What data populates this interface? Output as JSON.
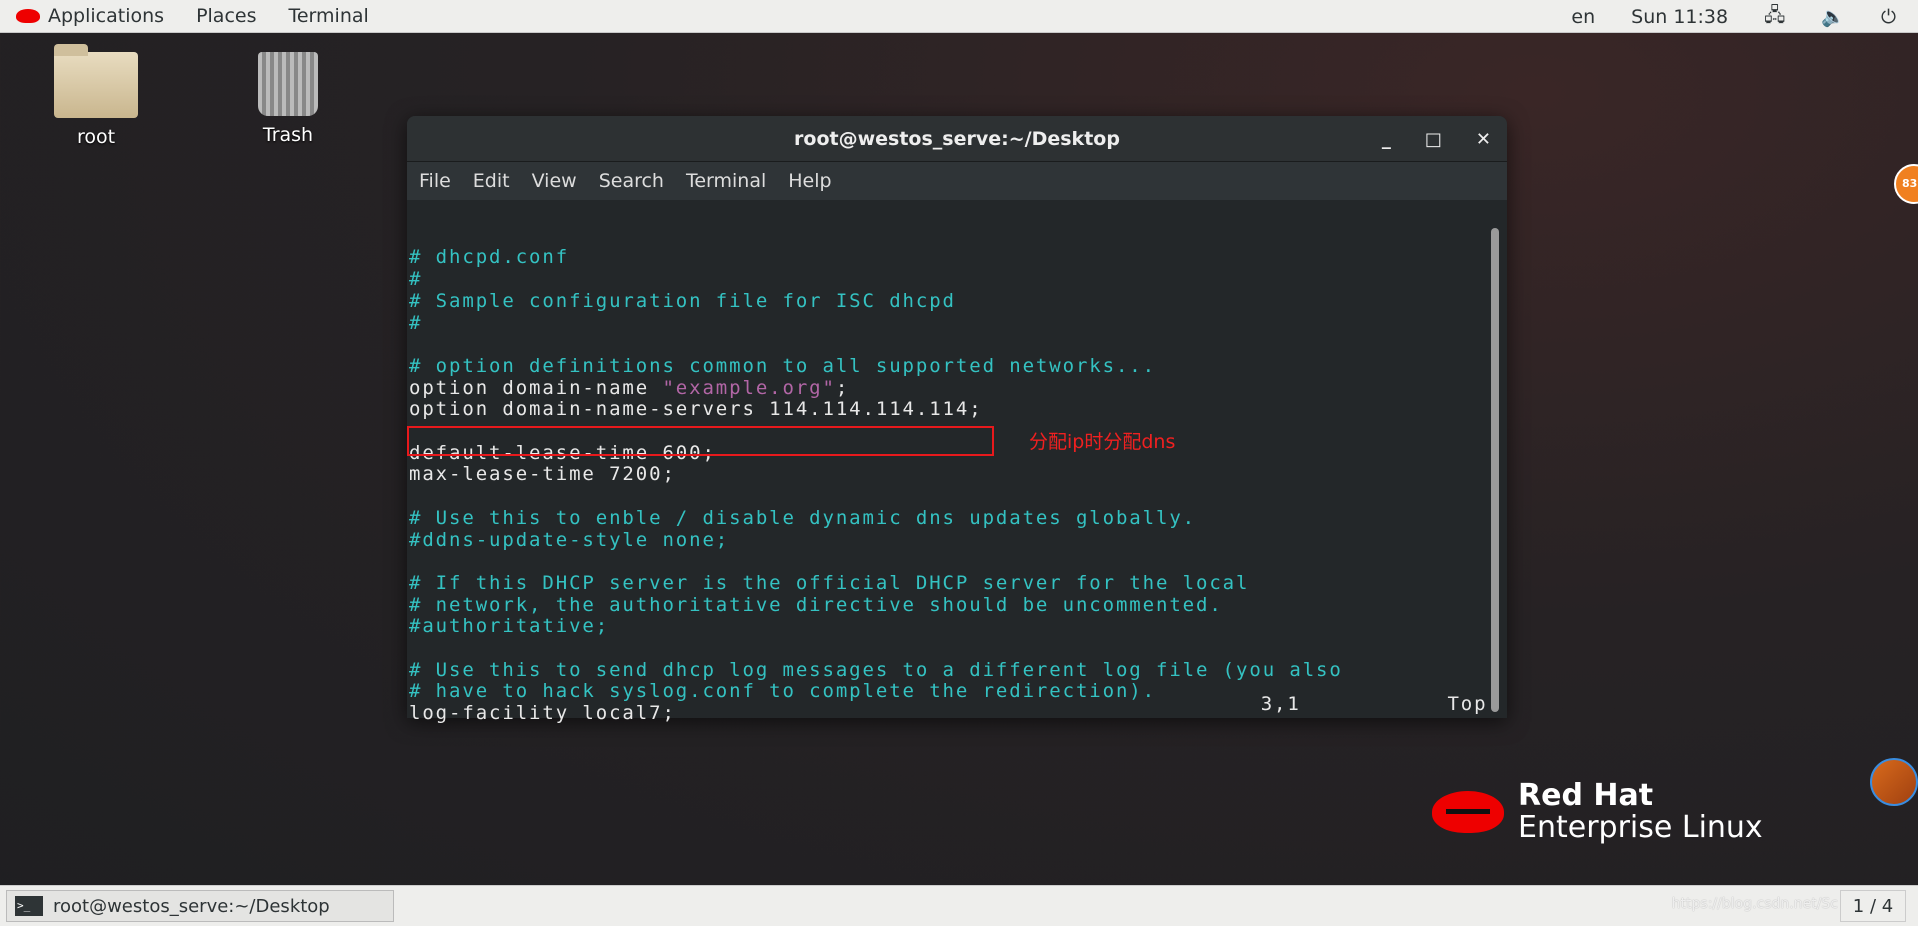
{
  "topbar": {
    "applications": "Applications",
    "places": "Places",
    "terminal": "Terminal",
    "lang": "en",
    "clock": "Sun 11:38"
  },
  "desktop": {
    "icons": [
      {
        "label": "root"
      },
      {
        "label": "Trash"
      }
    ]
  },
  "window": {
    "title": "root@westos_serve:~/Desktop",
    "minimize": "_",
    "maximize": "□",
    "close": "✕",
    "menu": [
      "File",
      "Edit",
      "View",
      "Search",
      "Terminal",
      "Help"
    ],
    "lines": [
      {
        "t": "# dhcpd.conf",
        "k": "c"
      },
      {
        "t": "#",
        "k": "c"
      },
      {
        "t": "# Sample configuration file for ISC dhcpd",
        "k": "c"
      },
      {
        "t": "#",
        "k": "c"
      },
      {
        "t": "",
        "k": "n"
      },
      {
        "t": "# option definitions common to all supported networks...",
        "k": "c"
      },
      {
        "t": "option domain-name ",
        "k": "n",
        "s": "\"example.org\"",
        "e": ";"
      },
      {
        "t": "option domain-name-servers 114.114.114.114;",
        "k": "n"
      },
      {
        "t": "",
        "k": "n"
      },
      {
        "t": "default-lease-time 600;",
        "k": "n"
      },
      {
        "t": "max-lease-time 7200;",
        "k": "n"
      },
      {
        "t": "",
        "k": "n"
      },
      {
        "t": "# Use this to enble / disable dynamic dns updates globally.",
        "k": "c"
      },
      {
        "t": "#ddns-update-style none;",
        "k": "c"
      },
      {
        "t": "",
        "k": "n"
      },
      {
        "t": "# If this DHCP server is the official DHCP server for the local",
        "k": "c"
      },
      {
        "t": "# network, the authoritative directive should be uncommented.",
        "k": "c"
      },
      {
        "t": "#authoritative;",
        "k": "c"
      },
      {
        "t": "",
        "k": "n"
      },
      {
        "t": "# Use this to send dhcp log messages to a different log file (you also",
        "k": "c"
      },
      {
        "t": "# have to hack syslog.conf to complete the redirection).",
        "k": "c"
      },
      {
        "t": "log-facility local7;",
        "k": "n"
      }
    ],
    "status": "                                                                3,1           Top",
    "annotation": "分配ip时分配dns"
  },
  "logo": {
    "line1": "Red Hat",
    "line2": "Enterprise Linux"
  },
  "taskbar": {
    "task": "root@westos_serve:~/Desktop",
    "workspace": "1 / 4",
    "watermark": "https://blog.csdn.net/Sc"
  },
  "badge": "83",
  "colors": {
    "comment": "#34c2c2",
    "string": "#b266a6",
    "highlight": "#e8191c"
  }
}
